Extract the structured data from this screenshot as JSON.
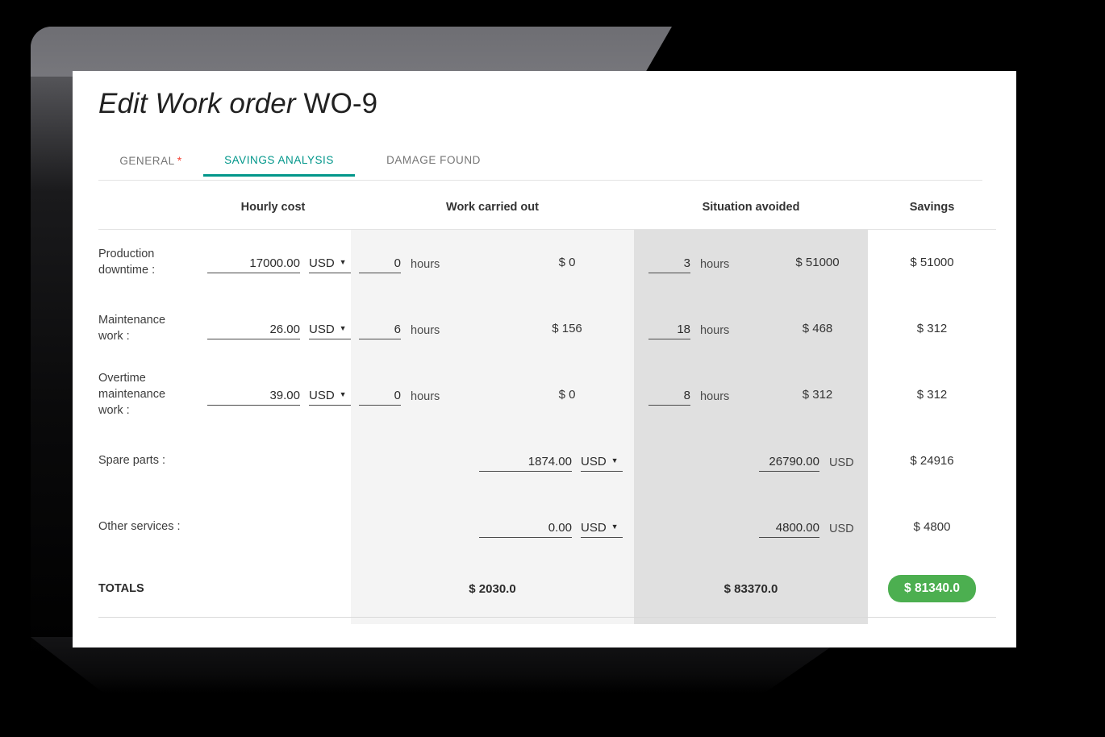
{
  "page": {
    "title_italic": "Edit Work order",
    "title_id": "WO-9"
  },
  "tabs": [
    {
      "label": "GENERAL",
      "required_marker": "*",
      "active": false
    },
    {
      "label": "SAVINGS ANALYSIS",
      "required_marker": "",
      "active": true
    },
    {
      "label": "DAMAGE FOUND",
      "required_marker": "",
      "active": false
    }
  ],
  "table": {
    "headers": {
      "label": "",
      "hourly_cost": "Hourly cost",
      "work_carried_out": "Work carried out",
      "situation_avoided": "Situation avoided",
      "savings": "Savings"
    },
    "units": {
      "hours": "hours",
      "currency": "USD",
      "dropdown_arrow": "▼"
    },
    "rows": [
      {
        "label": "Production downtime :",
        "hourly_value": "17000.00",
        "hourly_currency": "USD",
        "work_hours": "0",
        "work_unit": "hours",
        "work_amount": "$ 0",
        "avoided_hours": "3",
        "avoided_unit": "hours",
        "avoided_amount": "$ 51000",
        "savings": "$ 51000"
      },
      {
        "label": "Maintenance work :",
        "hourly_value": "26.00",
        "hourly_currency": "USD",
        "work_hours": "6",
        "work_unit": "hours",
        "work_amount": "$ 156",
        "avoided_hours": "18",
        "avoided_unit": "hours",
        "avoided_amount": "$ 468",
        "savings": "$ 312"
      },
      {
        "label": "Overtime maintenance work :",
        "hourly_value": "39.00",
        "hourly_currency": "USD",
        "work_hours": "0",
        "work_unit": "hours",
        "work_amount": "$ 0",
        "avoided_hours": "8",
        "avoided_unit": "hours",
        "avoided_amount": "$ 312",
        "savings": "$ 312"
      }
    ],
    "amount_rows": [
      {
        "label": "Spare parts :",
        "work_value": "1874.00",
        "work_currency": "USD",
        "avoided_value": "26790.00",
        "avoided_currency": "USD",
        "savings": "$ 24916"
      },
      {
        "label": "Other services :",
        "work_value": "0.00",
        "work_currency": "USD",
        "avoided_value": "4800.00",
        "avoided_currency": "USD",
        "savings": "$ 4800"
      }
    ],
    "totals": {
      "label": "TOTALS",
      "work_total": "$ 2030.0",
      "avoided_total": "$ 83370.0",
      "savings_total": "$ 81340.0"
    }
  },
  "colors": {
    "accent_teal": "#00968a",
    "savings_green": "#4caf50",
    "required_red": "#f44336",
    "band_work": "#f4f4f4",
    "band_avoided": "#e0e0e0"
  }
}
